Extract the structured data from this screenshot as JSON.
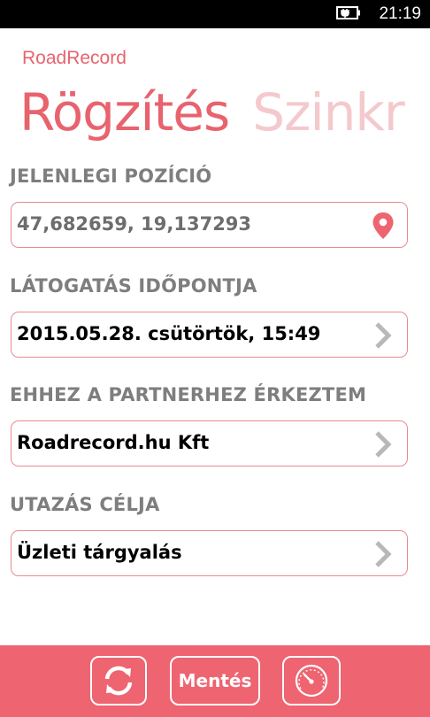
{
  "status_bar": {
    "time": "21:19",
    "icon": "battery-charging-icon"
  },
  "app": {
    "name": "RoadRecord"
  },
  "pivot": {
    "active": "Rögzítés",
    "next": "Szinkr"
  },
  "sections": {
    "position": {
      "label": "JELENLEGI POZÍCIÓ",
      "value": "47,682659, 19,137293",
      "icon": "map-pin-icon"
    },
    "visit_time": {
      "label": "LÁTOGATÁS IDŐPONTJA",
      "value": "2015.05.28. csütörtök, 15:49",
      "icon": "chevron-right-icon"
    },
    "partner": {
      "label": "EHHEZ A PARTNERHEZ ÉRKEZTEM",
      "value": "Roadrecord.hu Kft",
      "icon": "chevron-right-icon"
    },
    "purpose": {
      "label": "UTAZÁS CÉLJA",
      "value": "Üzleti tárgyalás",
      "icon": "chevron-right-icon"
    }
  },
  "app_bar": {
    "sync_icon": "sync-icon",
    "save_label": "Mentés",
    "dashboard_icon": "speedometer-icon"
  },
  "colors": {
    "accent": "#e8636e",
    "accent_light": "#f4c9cd",
    "bar": "#ee6470",
    "border": "#ea8a92",
    "label_gray": "#7e7e7e"
  }
}
